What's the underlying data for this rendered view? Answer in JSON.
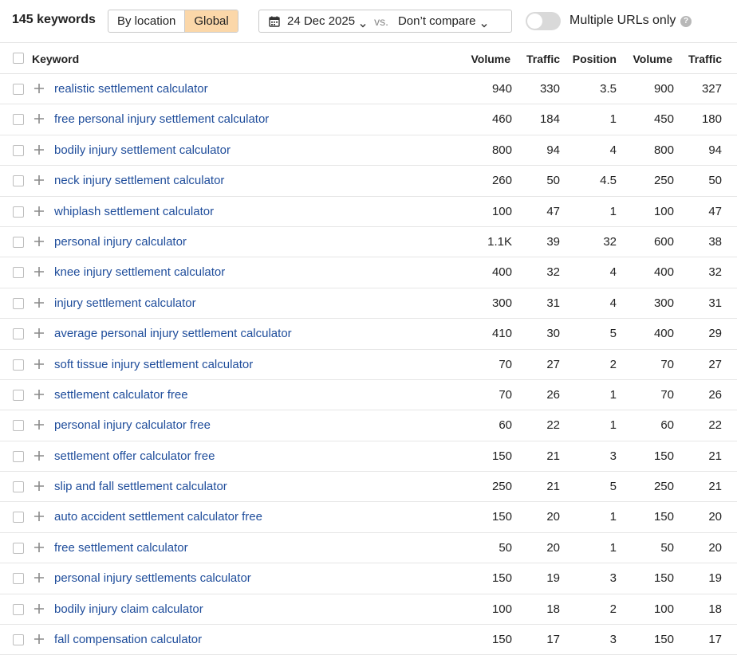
{
  "toolbar": {
    "keyword_count": "145 keywords",
    "scope_options": [
      "By location",
      "Global"
    ],
    "scope_selected": "Global",
    "date": "24 Dec 2025",
    "vs_label": "vs.",
    "compare": "Don’t compare",
    "toggle_label": "Multiple URLs only",
    "toggle_on": false,
    "help_glyph": "?"
  },
  "table": {
    "headers": {
      "keyword": "Keyword",
      "volume": "Volume",
      "traffic": "Traffic",
      "position": "Position",
      "volume2": "Volume",
      "traffic2": "Traffic"
    },
    "rows": [
      {
        "keyword": "realistic settlement calculator",
        "volume": "940",
        "traffic": "330",
        "position": "3.5",
        "volume2": "900",
        "traffic2": "327"
      },
      {
        "keyword": "free personal injury settlement calculator",
        "volume": "460",
        "traffic": "184",
        "position": "1",
        "volume2": "450",
        "traffic2": "180"
      },
      {
        "keyword": "bodily injury settlement calculator",
        "volume": "800",
        "traffic": "94",
        "position": "4",
        "volume2": "800",
        "traffic2": "94"
      },
      {
        "keyword": "neck injury settlement calculator",
        "volume": "260",
        "traffic": "50",
        "position": "4.5",
        "volume2": "250",
        "traffic2": "50"
      },
      {
        "keyword": "whiplash settlement calculator",
        "volume": "100",
        "traffic": "47",
        "position": "1",
        "volume2": "100",
        "traffic2": "47"
      },
      {
        "keyword": "personal injury calculator",
        "volume": "1.1K",
        "traffic": "39",
        "position": "32",
        "volume2": "600",
        "traffic2": "38"
      },
      {
        "keyword": "knee injury settlement calculator",
        "volume": "400",
        "traffic": "32",
        "position": "4",
        "volume2": "400",
        "traffic2": "32"
      },
      {
        "keyword": "injury settlement calculator",
        "volume": "300",
        "traffic": "31",
        "position": "4",
        "volume2": "300",
        "traffic2": "31"
      },
      {
        "keyword": "average personal injury settlement calculator",
        "volume": "410",
        "traffic": "30",
        "position": "5",
        "volume2": "400",
        "traffic2": "29"
      },
      {
        "keyword": "soft tissue injury settlement calculator",
        "volume": "70",
        "traffic": "27",
        "position": "2",
        "volume2": "70",
        "traffic2": "27"
      },
      {
        "keyword": "settlement calculator free",
        "volume": "70",
        "traffic": "26",
        "position": "1",
        "volume2": "70",
        "traffic2": "26"
      },
      {
        "keyword": "personal injury calculator free",
        "volume": "60",
        "traffic": "22",
        "position": "1",
        "volume2": "60",
        "traffic2": "22"
      },
      {
        "keyword": "settlement offer calculator free",
        "volume": "150",
        "traffic": "21",
        "position": "3",
        "volume2": "150",
        "traffic2": "21"
      },
      {
        "keyword": "slip and fall settlement calculator",
        "volume": "250",
        "traffic": "21",
        "position": "5",
        "volume2": "250",
        "traffic2": "21"
      },
      {
        "keyword": "auto accident settlement calculator free",
        "volume": "150",
        "traffic": "20",
        "position": "1",
        "volume2": "150",
        "traffic2": "20"
      },
      {
        "keyword": "free settlement calculator",
        "volume": "50",
        "traffic": "20",
        "position": "1",
        "volume2": "50",
        "traffic2": "20"
      },
      {
        "keyword": "personal injury settlements calculator",
        "volume": "150",
        "traffic": "19",
        "position": "3",
        "volume2": "150",
        "traffic2": "19"
      },
      {
        "keyword": "bodily injury claim calculator",
        "volume": "100",
        "traffic": "18",
        "position": "2",
        "volume2": "100",
        "traffic2": "18"
      },
      {
        "keyword": "fall compensation calculator",
        "volume": "150",
        "traffic": "17",
        "position": "3",
        "volume2": "150",
        "traffic2": "17"
      }
    ]
  }
}
